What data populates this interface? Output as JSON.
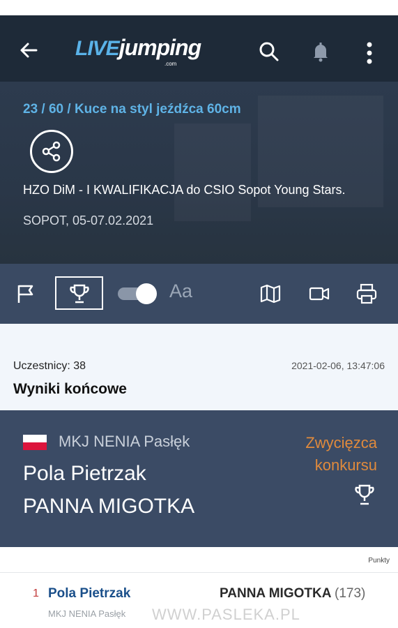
{
  "appbar": {
    "logo_live": "LIVE",
    "logo_jumping": "jumping",
    "logo_com": ".com"
  },
  "hero": {
    "competition_title": "23 / 60 / Kuce na styl jeźdźca 60cm",
    "event_name": "HZO DiM - I KWALIFIKACJA do CSIO Sopot Young Stars.",
    "location_dates": "SOPOT, 05-07.02.2021"
  },
  "toolbar": {
    "font_label": "Aa"
  },
  "info": {
    "participants": "Uczestnicy: 38",
    "timestamp": "2021-02-06, 13:47:06",
    "results_title": "Wyniki końcowe"
  },
  "winner": {
    "club": "MKJ NENIA Pasłęk",
    "rider": "Pola Pietrzak",
    "horse": "PANNA MIGOTKA",
    "label": "Zwycięzca konkursu"
  },
  "results": {
    "points_header": "Punkty",
    "rows": [
      {
        "rank": "1",
        "rider": "Pola Pietrzak",
        "horse": "PANNA MIGOTKA",
        "horse_number": "(173)",
        "subline": "MKJ NENIA Pasłęk"
      }
    ]
  },
  "watermark": "WWW.PASLEKA.PL",
  "colors": {
    "appbar": "#1e2a38",
    "accent_blue": "#5fb3e6",
    "winner_bg": "#3b4b65",
    "winner_label": "#e08a3c"
  }
}
